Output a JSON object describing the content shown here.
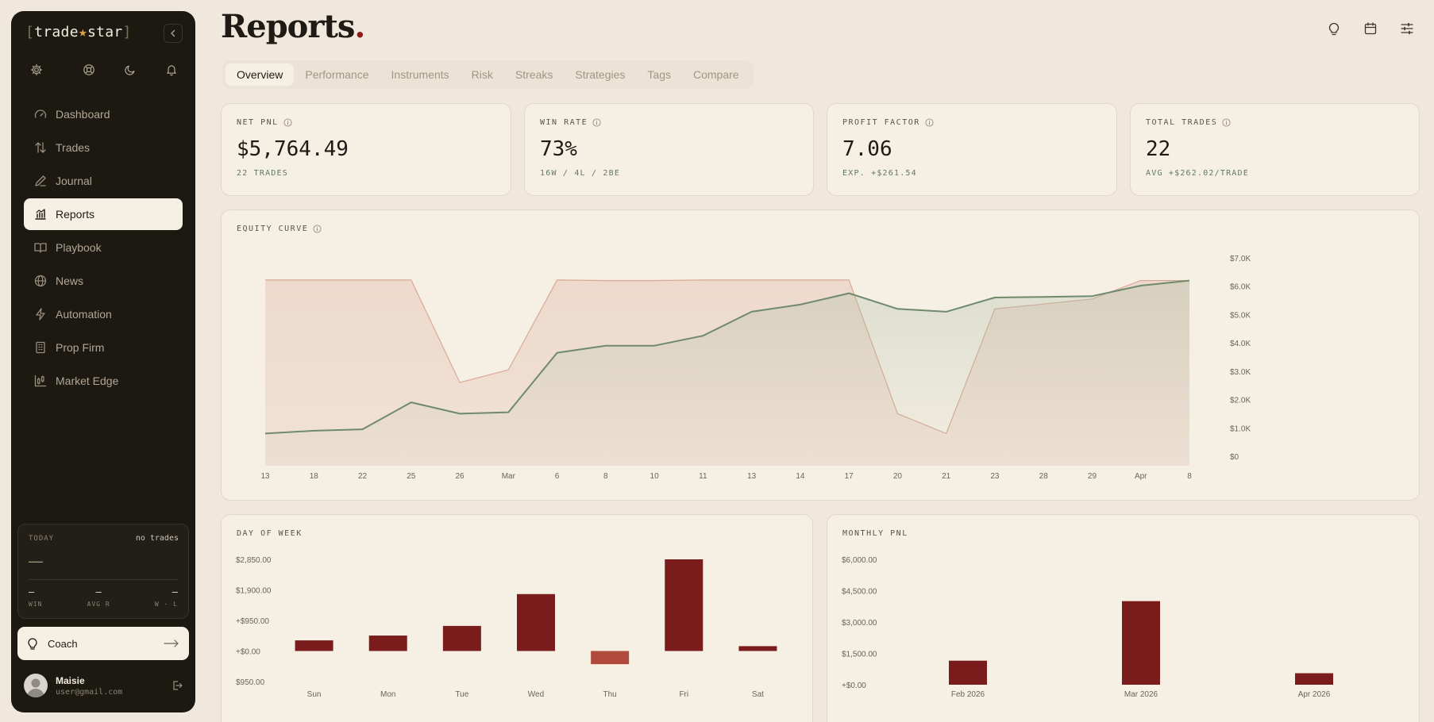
{
  "sidebar": {
    "brand": {
      "left": "[",
      "a": "trade",
      "star": "★",
      "b": "star",
      "right": "]"
    },
    "nav": [
      {
        "label": "Dashboard",
        "icon": "gauge-icon"
      },
      {
        "label": "Trades",
        "icon": "arrows-updown-icon"
      },
      {
        "label": "Journal",
        "icon": "pen-icon"
      },
      {
        "label": "Reports",
        "icon": "bar-chart-icon",
        "active": true
      },
      {
        "label": "Playbook",
        "icon": "book-icon"
      },
      {
        "label": "News",
        "icon": "globe-icon"
      },
      {
        "label": "Automation",
        "icon": "bolt-icon"
      },
      {
        "label": "Prop Firm",
        "icon": "building-icon"
      },
      {
        "label": "Market Edge",
        "icon": "candles-icon"
      }
    ],
    "today": {
      "label": "TODAY",
      "status": "no trades",
      "value": "—",
      "stats": [
        {
          "value": "—",
          "label": "WIN"
        },
        {
          "value": "—",
          "label": "AVG R"
        },
        {
          "value": "—",
          "label": "W · L"
        }
      ]
    },
    "coach_label": "Coach",
    "user": {
      "name": "Maisie",
      "email": "user@gmail.com"
    }
  },
  "header": {
    "title": "Reports",
    "title_dot": ".",
    "tabs": [
      "Overview",
      "Performance",
      "Instruments",
      "Risk",
      "Streaks",
      "Strategies",
      "Tags",
      "Compare"
    ],
    "active_tab": "Overview"
  },
  "kpis": [
    {
      "label": "NET PNL",
      "value": "$5,764.49",
      "sub": "22 TRADES"
    },
    {
      "label": "WIN RATE",
      "value": "73%",
      "sub": "16W / 4L / 2BE"
    },
    {
      "label": "PROFIT FACTOR",
      "value": "7.06",
      "sub": "EXP. +$261.54"
    },
    {
      "label": "TOTAL TRADES",
      "value": "22",
      "sub": "AVG +$262.02/TRADE"
    }
  ],
  "colors": {
    "accent_green": "#6e8a6b",
    "bar_red": "#7a1c1c",
    "bar_red_neg": "#b04a3c",
    "drawdown_stroke": "#d9a796"
  },
  "chart_data": [
    {
      "type": "line",
      "title": "EQUITY CURVE",
      "categories": [
        "13",
        "18",
        "22",
        "25",
        "26",
        "Mar",
        "6",
        "8",
        "10",
        "11",
        "13",
        "14",
        "17",
        "20",
        "21",
        "23",
        "28",
        "29",
        "Apr",
        "8"
      ],
      "series": [
        {
          "values": [
            800,
            900,
            950,
            1900,
            1500,
            1550,
            3650,
            3900,
            3900,
            4250,
            5100,
            5350,
            5750,
            5200,
            5100,
            5600,
            5620,
            5650,
            6020,
            6200
          ]
        },
        {
          "values": [
            6220,
            6220,
            6220,
            6220,
            2600,
            3050,
            6220,
            6200,
            6200,
            6220,
            6220,
            6220,
            6220,
            1500,
            800,
            5200,
            5370,
            5550,
            6200,
            6200
          ]
        }
      ],
      "yticks": [
        "$0",
        "$1.0K",
        "$2.0K",
        "$3.0K",
        "$4.0K",
        "$5.0K",
        "$6.0K",
        "$7.0K"
      ],
      "ylim": [
        0,
        7000
      ],
      "grid": false
    },
    {
      "type": "bar",
      "title": "DAY OF WEEK",
      "categories": [
        "Sun",
        "Mon",
        "Tue",
        "Wed",
        "Thu",
        "Fri",
        "Sat"
      ],
      "values": [
        330,
        480,
        780,
        1770,
        -410,
        2850,
        150
      ],
      "yticks": [
        "$950.00",
        "+$0.00",
        "+$950.00",
        "$1,900.00",
        "$2,850.00"
      ],
      "ylim": [
        -950,
        2850
      ]
    },
    {
      "type": "bar",
      "title": "MONTHLY PNL",
      "categories": [
        "Feb 2026",
        "Mar 2026",
        "Apr 2026"
      ],
      "values": [
        1150,
        4000,
        550
      ],
      "yticks": [
        "+$0.00",
        "$1,500.00",
        "$3,000.00",
        "$4,500.00",
        "$6,000.00"
      ],
      "ylim": [
        0,
        6000
      ]
    }
  ]
}
